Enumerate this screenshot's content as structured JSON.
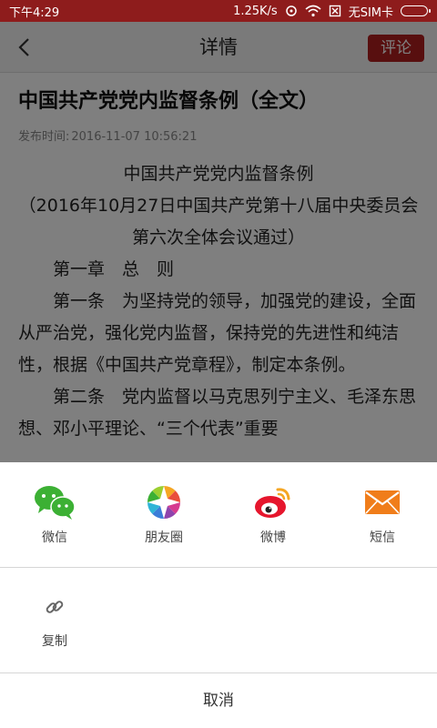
{
  "status_bar": {
    "time": "下午4:29",
    "speed": "1.25K/s",
    "sim": "无SIM卡"
  },
  "nav": {
    "title": "详情",
    "comment_label": "评论"
  },
  "article": {
    "title": "中国共产党党内监督条例（全文）",
    "publish_label": "发布时间:",
    "publish_time": "2016-11-07 10:56:21",
    "paragraphs": [
      "中国共产党党内监督条例",
      "（2016年10月27日中国共产党第十八届中央委员会第六次全体会议通过）",
      "第一章　总　则",
      "第一条　为坚持党的领导，加强党的建设，全面从严治党，强化党内监督，保持党的先进性和纯洁性，根据《中国共产党章程》，制定本条例。",
      "第二条　党内监督以马克思列宁主义、毛泽东思想、邓小平理论、“三个代表”重要"
    ]
  },
  "share_sheet": {
    "items": [
      {
        "label": "微信",
        "icon": "wechat-icon"
      },
      {
        "label": "朋友圈",
        "icon": "moments-icon"
      },
      {
        "label": "微博",
        "icon": "weibo-icon"
      },
      {
        "label": "短信",
        "icon": "sms-icon"
      }
    ],
    "copy_label": "复制",
    "cancel_label": "取消"
  },
  "colors": {
    "brand_red": "#b01f1f",
    "status_bar": "#8e1c1c",
    "wechat_green": "#3cb034",
    "sms_orange": "#f07d1a"
  }
}
